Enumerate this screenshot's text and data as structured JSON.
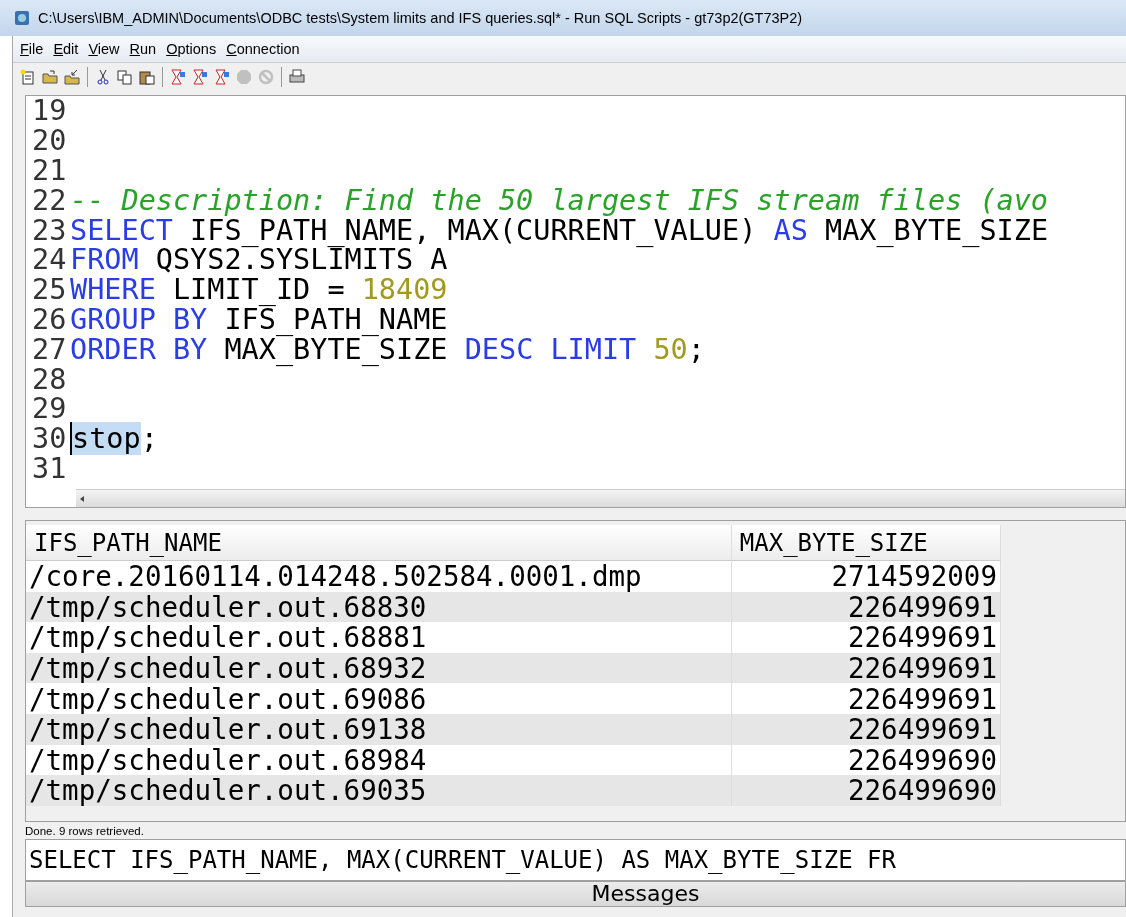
{
  "window": {
    "title": "C:\\Users\\IBM_ADMIN\\Documents\\ODBC tests\\System limits and IFS queries.sql* - Run SQL Scripts - gt73p2(GT73P2)"
  },
  "menu": [
    "File",
    "Edit",
    "View",
    "Run",
    "Options",
    "Connection"
  ],
  "toolbar": [
    {
      "kind": "new",
      "disabled": false
    },
    {
      "kind": "open",
      "disabled": false
    },
    {
      "kind": "save",
      "disabled": false
    },
    {
      "kind": "sep"
    },
    {
      "kind": "cut",
      "disabled": false
    },
    {
      "kind": "copy",
      "disabled": false
    },
    {
      "kind": "paste",
      "disabled": false
    },
    {
      "kind": "sep"
    },
    {
      "kind": "run",
      "disabled": false
    },
    {
      "kind": "run",
      "disabled": false
    },
    {
      "kind": "run",
      "disabled": false
    },
    {
      "kind": "stop",
      "disabled": true
    },
    {
      "kind": "cancel",
      "disabled": true
    },
    {
      "kind": "sep"
    },
    {
      "kind": "print",
      "disabled": false
    }
  ],
  "editor": {
    "lines": [
      {
        "number": "19"
      },
      {
        "number": "20"
      },
      {
        "number": "21"
      },
      {
        "number": "22",
        "tokens": [
          {
            "kind": "comment",
            "text": "-- Description: Find the 50 largest IFS stream files (avo",
            "selected": false
          }
        ]
      },
      {
        "number": "23",
        "tokens": [
          {
            "kind": "keyword",
            "text": "SELECT",
            "selected": false
          },
          {
            "kind": "plain",
            "text": " IFS_PATH_NAME, MAX(CURRENT_VALUE) ",
            "selected": false
          },
          {
            "kind": "keyword",
            "text": "AS",
            "selected": false
          },
          {
            "kind": "plain",
            "text": " MAX_BYTE_SIZE",
            "selected": false
          }
        ]
      },
      {
        "number": "24",
        "tokens": [
          {
            "kind": "keyword",
            "text": "FROM",
            "selected": false
          },
          {
            "kind": "plain",
            "text": " QSYS2.SYSLIMITS A",
            "selected": false
          }
        ]
      },
      {
        "number": "25",
        "tokens": [
          {
            "kind": "keyword",
            "text": "WHERE",
            "selected": false
          },
          {
            "kind": "plain",
            "text": " LIMIT_ID = ",
            "selected": false
          },
          {
            "kind": "number",
            "text": "18409",
            "selected": false
          }
        ]
      },
      {
        "number": "26",
        "tokens": [
          {
            "kind": "keyword",
            "text": "GROUP BY",
            "selected": false
          },
          {
            "kind": "plain",
            "text": " IFS_PATH_NAME",
            "selected": false
          }
        ]
      },
      {
        "number": "27",
        "tokens": [
          {
            "kind": "keyword",
            "text": "ORDER BY",
            "selected": false
          },
          {
            "kind": "plain",
            "text": " MAX_BYTE_SIZE ",
            "selected": false
          },
          {
            "kind": "keyword",
            "text": "DESC LIMIT ",
            "selected": false
          },
          {
            "kind": "number",
            "text": "50",
            "selected": false
          },
          {
            "kind": "plain",
            "text": ";",
            "selected": false
          }
        ]
      },
      {
        "number": "28"
      },
      {
        "number": "29"
      },
      {
        "number": "30",
        "tokens": [
          {
            "kind": "plain",
            "text": "stop",
            "selected": true
          },
          {
            "kind": "plain",
            "text": ";",
            "selected": false
          }
        ]
      },
      {
        "number": "31"
      }
    ]
  },
  "results": {
    "columns": [
      "IFS_PATH_NAME",
      "MAX_BYTE_SIZE"
    ],
    "rows": [
      [
        "/core.20160114.014248.502584.0001.dmp",
        "2714592009"
      ],
      [
        "/tmp/scheduler.out.68830",
        "226499691"
      ],
      [
        "/tmp/scheduler.out.68881",
        "226499691"
      ],
      [
        "/tmp/scheduler.out.68932",
        "226499691"
      ],
      [
        "/tmp/scheduler.out.69086",
        "226499691"
      ],
      [
        "/tmp/scheduler.out.69138",
        "226499691"
      ],
      [
        "/tmp/scheduler.out.68984",
        "226499690"
      ],
      [
        "/tmp/scheduler.out.69035",
        "226499690"
      ]
    ]
  },
  "status_bar": "Done. 9 rows retrieved.",
  "message_line": "SELECT IFS_PATH_NAME, MAX(CURRENT_VALUE) AS MAX_BYTE_SIZE FR",
  "bottom_tab": "Messages"
}
